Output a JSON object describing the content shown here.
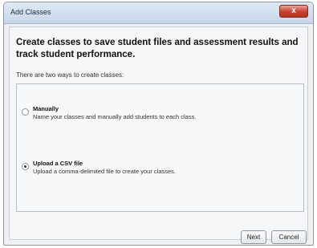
{
  "window": {
    "title": "Add Classes",
    "close_glyph": "x"
  },
  "dialog": {
    "heading": "Create classes to save student files and assessment results and track student performance.",
    "intro": "There are two ways to create classes:"
  },
  "options": [
    {
      "title": "Manually",
      "description": "Name your classes and manually add students to each class.",
      "selected": false
    },
    {
      "title": "Upload a CSV file",
      "description": "Upload a comma-delimited file to create your classes.",
      "selected": true
    }
  ],
  "buttons": {
    "next_label": "Next",
    "cancel_label": "Cancel"
  },
  "colors": {
    "close_button": "#c8412c",
    "titlebar": "#c6d6ea"
  }
}
